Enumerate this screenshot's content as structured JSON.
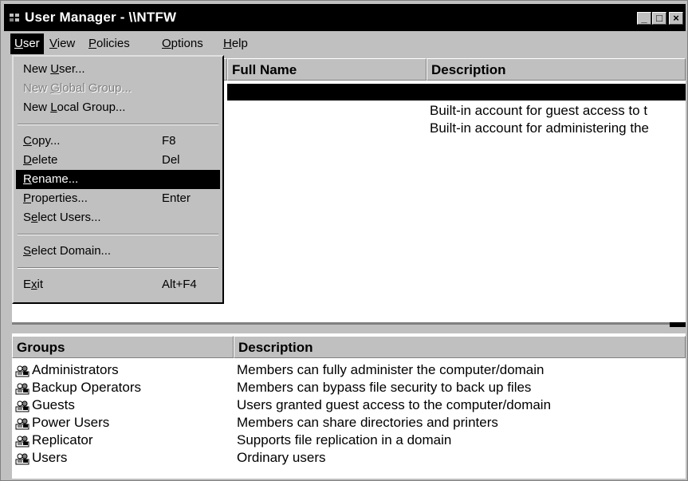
{
  "window": {
    "title": "User Manager - \\\\NTFW"
  },
  "titlebar_buttons": {
    "minimize": "_",
    "maximize": "□",
    "close": "×"
  },
  "menubar": {
    "items": [
      {
        "label": "User",
        "mnemonic": "U",
        "rest": "ser"
      },
      {
        "label": "View",
        "mnemonic": "V",
        "rest": "iew"
      },
      {
        "label": "Policies",
        "mnemonic": "P",
        "rest": "olicies"
      },
      {
        "label": "Options",
        "mnemonic": "O",
        "rest": "ptions"
      },
      {
        "label": "Help",
        "mnemonic": "H",
        "rest": "elp"
      }
    ]
  },
  "user_menu": {
    "items": [
      {
        "pre": "New ",
        "mn": "U",
        "post": "ser...",
        "accel": "",
        "disabled": false
      },
      {
        "pre": "New ",
        "mn": "G",
        "post": "lobal Group...",
        "accel": "",
        "disabled": true
      },
      {
        "pre": "New ",
        "mn": "L",
        "post": "ocal Group...",
        "accel": "",
        "disabled": false
      },
      {
        "pre": "",
        "mn": "C",
        "post": "opy...",
        "accel": "F8",
        "disabled": false
      },
      {
        "pre": "",
        "mn": "D",
        "post": "elete",
        "accel": "Del",
        "disabled": false
      },
      {
        "pre": "",
        "mn": "R",
        "post": "ename...",
        "accel": "",
        "disabled": false,
        "highlighted": true
      },
      {
        "pre": "",
        "mn": "P",
        "post": "roperties...",
        "accel": "Enter",
        "disabled": false
      },
      {
        "pre": "S",
        "mn": "e",
        "post": "lect Users...",
        "accel": "",
        "disabled": false
      },
      {
        "pre": "",
        "mn": "S",
        "post": "elect Domain...",
        "accel": "",
        "disabled": false
      },
      {
        "pre": "E",
        "mn": "x",
        "post": "it",
        "accel": "Alt+F4",
        "disabled": false
      }
    ]
  },
  "users_pane": {
    "columns": {
      "full_name": "Full Name",
      "description": "Description"
    },
    "rows": [
      {
        "description": ""
      },
      {
        "description": "Built-in account for guest access to t"
      },
      {
        "description": "Built-in account for administering the"
      }
    ]
  },
  "groups_pane": {
    "columns": {
      "groups": "Groups",
      "description": "Description"
    },
    "icon": "group-icon",
    "rows": [
      {
        "name": "Administrators",
        "description": "Members can fully administer the computer/domain"
      },
      {
        "name": "Backup Operators",
        "description": "Members can bypass file security to back up files"
      },
      {
        "name": "Guests",
        "description": "Users granted guest access to the computer/domain"
      },
      {
        "name": "Power Users",
        "description": "Members can share directories and printers"
      },
      {
        "name": "Replicator",
        "description": "Supports file replication in a domain"
      },
      {
        "name": "Users",
        "description": "Ordinary users"
      }
    ]
  },
  "colors": {
    "face": "#c0c0c0",
    "highlight": "#000000",
    "disabled": "#808080",
    "window": "#ffffff"
  }
}
